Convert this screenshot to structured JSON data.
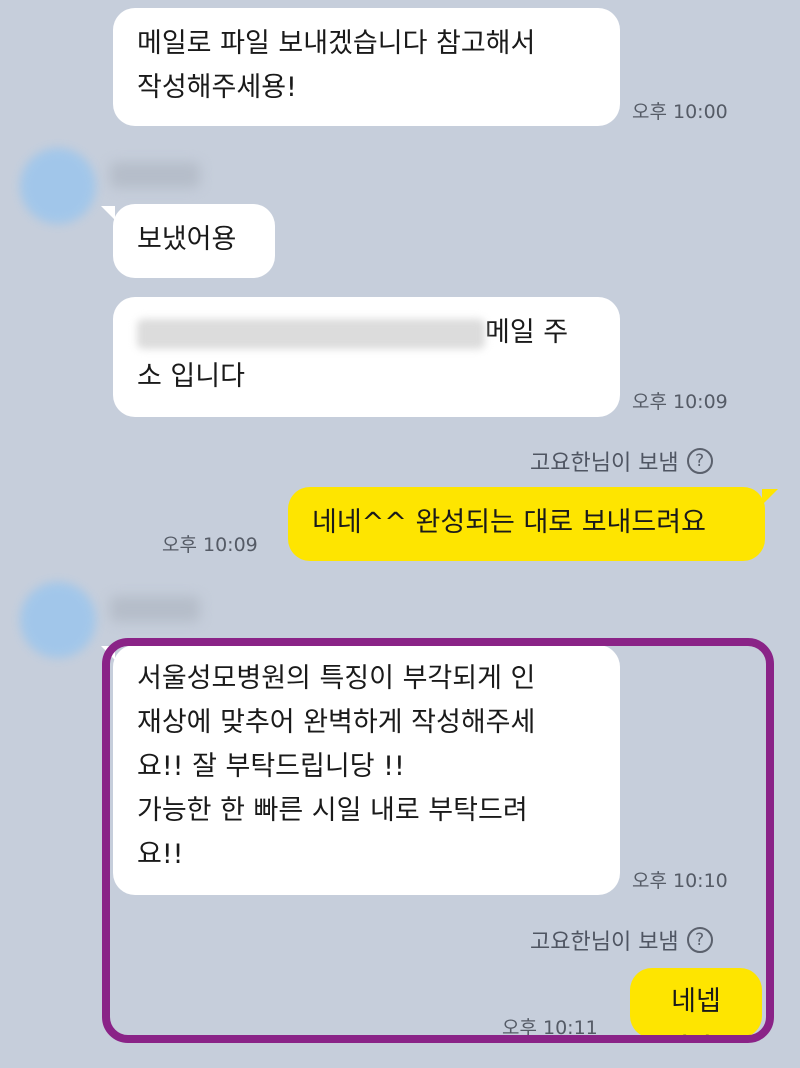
{
  "messages": [
    {
      "text": "메일로 파일 보내겠습니다 참고해서\n작성해주세용!",
      "time": "오후 10:00"
    },
    {
      "text": "보냈어용"
    },
    {
      "text_after_email": "메일 주",
      "text_line2": "소 입니다",
      "time": "오후 10:09"
    },
    {
      "text": "네네^^ 완성되는 대로 보내드려요",
      "time": "오후 10:09"
    },
    {
      "text": "서울성모병원의 특징이 부각되게 인\n재상에 맞추어 완벽하게 작성해주세\n요!! 잘 부탁드립니당 !!\n가능한 한 빠른 시일 내로 부탁드려\n요!!",
      "time": "오후 10:10"
    },
    {
      "text": "네넵^^",
      "time": "오후 10:11"
    }
  ],
  "sender_note_1": "고요한님이 보냄",
  "sender_note_2": "고요한님이 보냄",
  "help_glyph": "?",
  "colors": {
    "background": "#c6cedb",
    "my_bubble": "#fee500",
    "their_bubble": "#ffffff",
    "highlight": "#8a2387"
  },
  "icons": {
    "help": "question-circle-icon",
    "avatar": "blurred-avatar"
  }
}
